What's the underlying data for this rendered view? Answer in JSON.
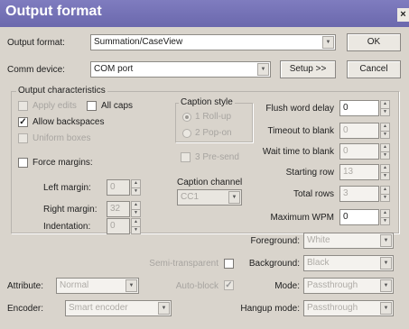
{
  "window": {
    "title": "Output format",
    "close_glyph": "×"
  },
  "output_format": {
    "label": "Output format:",
    "value": "Summation/CaseView"
  },
  "comm_device": {
    "label": "Comm device:",
    "value": "COM port",
    "setup_label": "Setup >>"
  },
  "buttons": {
    "ok": "OK",
    "cancel": "Cancel"
  },
  "characteristics": {
    "group_label": "Output characteristics",
    "apply_edits": {
      "label": "Apply edits",
      "checked": false,
      "enabled": false
    },
    "all_caps": {
      "label": "All caps",
      "checked": false,
      "enabled": true
    },
    "allow_backspaces": {
      "label": "Allow backspaces",
      "checked": true,
      "enabled": true
    },
    "uniform_boxes": {
      "label": "Uniform boxes",
      "checked": false,
      "enabled": false
    },
    "force_margins": {
      "label": "Force margins:",
      "checked": false,
      "enabled": true
    },
    "left_margin": {
      "label": "Left margin:",
      "value": "0"
    },
    "right_margin": {
      "label": "Right margin:",
      "value": "32"
    },
    "indentation": {
      "label": "Indentation:",
      "value": "0"
    },
    "caption_style": {
      "label": "Caption style",
      "options": [
        "1 Roll-up",
        "2 Pop-on"
      ],
      "selected": "1 Roll-up"
    },
    "three_presend": {
      "label": "3 Pre-send",
      "checked": false,
      "enabled": false
    },
    "caption_channel": {
      "label": "Caption channel",
      "value": "CC1"
    },
    "flush_word_delay": {
      "label": "Flush word delay",
      "value": "0"
    },
    "timeout_to_blank": {
      "label": "Timeout to blank",
      "value": "0"
    },
    "wait_time_to_blank": {
      "label": "Wait time to blank",
      "value": "0"
    },
    "starting_row": {
      "label": "Starting row",
      "value": "13"
    },
    "total_rows": {
      "label": "Total rows",
      "value": "3"
    },
    "maximum_wpm": {
      "label": "Maximum WPM",
      "value": "0"
    }
  },
  "foreground": {
    "label": "Foreground:",
    "value": "White"
  },
  "background": {
    "label": "Background:",
    "value": "Black"
  },
  "semi_transparent": {
    "label": "Semi-transparent",
    "checked": false
  },
  "auto_block": {
    "label": "Auto-block",
    "checked": true
  },
  "attribute": {
    "label": "Attribute:",
    "value": "Normal"
  },
  "mode": {
    "label": "Mode:",
    "value": "Passthrough"
  },
  "encoder": {
    "label": "Encoder:",
    "value": "Smart encoder"
  },
  "hangup_mode": {
    "label": "Hangup mode:",
    "value": "Passthrough"
  },
  "glyphs": {
    "check": "✓",
    "drop": "▼",
    "up": "▲",
    "down": "▼"
  },
  "colors": {
    "titlebar": "#6b68ad",
    "window_bg": "#d9d4cc"
  }
}
